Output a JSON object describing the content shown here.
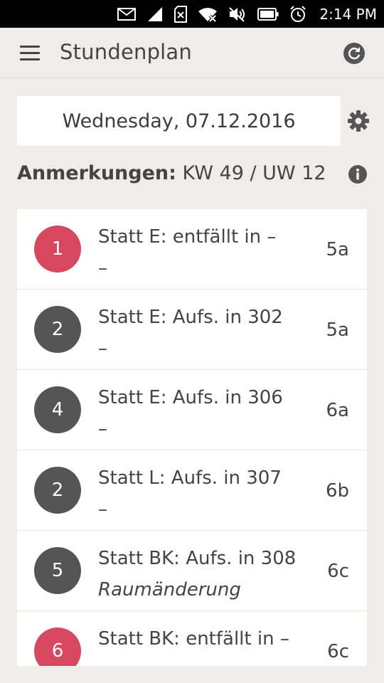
{
  "status_bar": {
    "time": "2:14 PM",
    "icons": [
      "mail-icon",
      "signal-icon",
      "no-sim-icon",
      "wifi-icon",
      "mute-icon",
      "battery-icon",
      "alarm-icon"
    ]
  },
  "app_bar": {
    "title": "Stundenplan",
    "menu_icon": "hamburger-icon",
    "refresh_icon": "refresh-icon"
  },
  "date": {
    "value": "Wednesday, 07.12.2016",
    "settings_icon": "gear-icon"
  },
  "notes": {
    "label": "Anmerkungen:",
    "value": "KW 49 / UW 12",
    "info_icon": "info-icon"
  },
  "colors": {
    "red_badge": "#d7485f",
    "dark_badge": "#555555",
    "background": "#efedea"
  },
  "entries": [
    {
      "period": "1",
      "color": "red",
      "text": "Statt E:  entfällt  in –",
      "note": "–",
      "note_italic": false,
      "class": "5a"
    },
    {
      "period": "2",
      "color": "dark",
      "text": "Statt E:  Aufs.  in 302",
      "note": "–",
      "note_italic": false,
      "class": "5a"
    },
    {
      "period": "4",
      "color": "dark",
      "text": "Statt E:  Aufs.  in 306",
      "note": "–",
      "note_italic": false,
      "class": "6a"
    },
    {
      "period": "2",
      "color": "dark",
      "text": "Statt L:  Aufs.  in 307",
      "note": "–",
      "note_italic": false,
      "class": "6b"
    },
    {
      "period": "5",
      "color": "dark",
      "text": "Statt BK:  Aufs.  in 308",
      "note": "Raumänderung",
      "note_italic": true,
      "class": "6c"
    },
    {
      "period": "6",
      "color": "red",
      "text": "Statt BK:  entfällt  in –",
      "note": "",
      "note_italic": false,
      "class": "6c"
    }
  ]
}
